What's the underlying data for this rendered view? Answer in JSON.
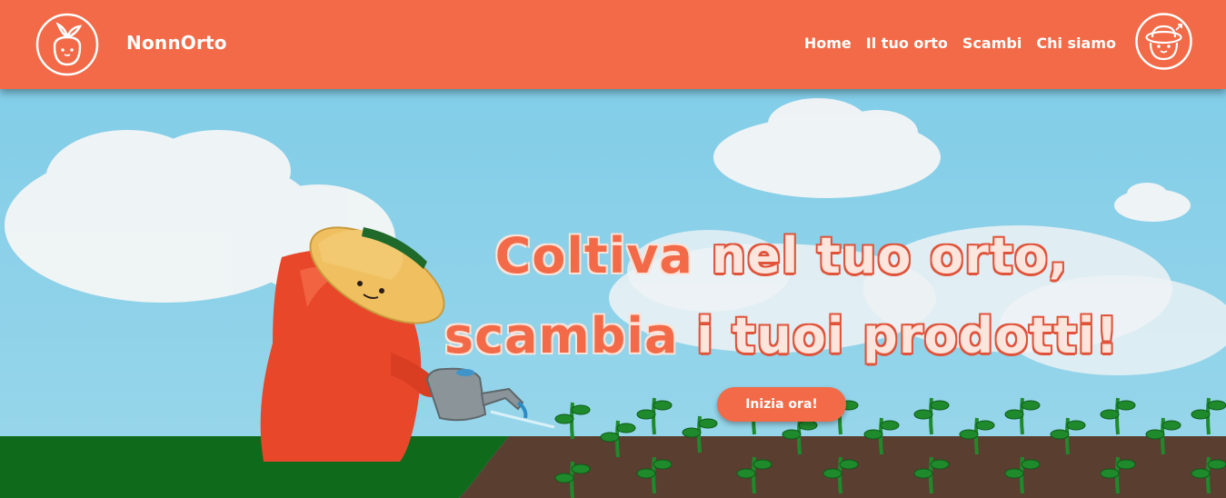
{
  "header": {
    "brand": "NonnOrto",
    "nav": [
      "Home",
      "Il tuo orto",
      "Scambi",
      "Chi siamo"
    ]
  },
  "hero": {
    "line1_accent": "Coltiva",
    "line1_rest": " nel tuo orto,",
    "line2_accent": "scambia",
    "line2_rest": " i tuoi prodotti!",
    "cta": "Inizia ora!"
  },
  "colors": {
    "brand": "#f26a47",
    "sky": "#8fd0e6",
    "grass": "#0f6a1c",
    "soil": "#5a3e30",
    "sprout": "#1f8a2c"
  },
  "icons": [
    "sprout-logo-icon",
    "farmer-avatar-icon"
  ]
}
